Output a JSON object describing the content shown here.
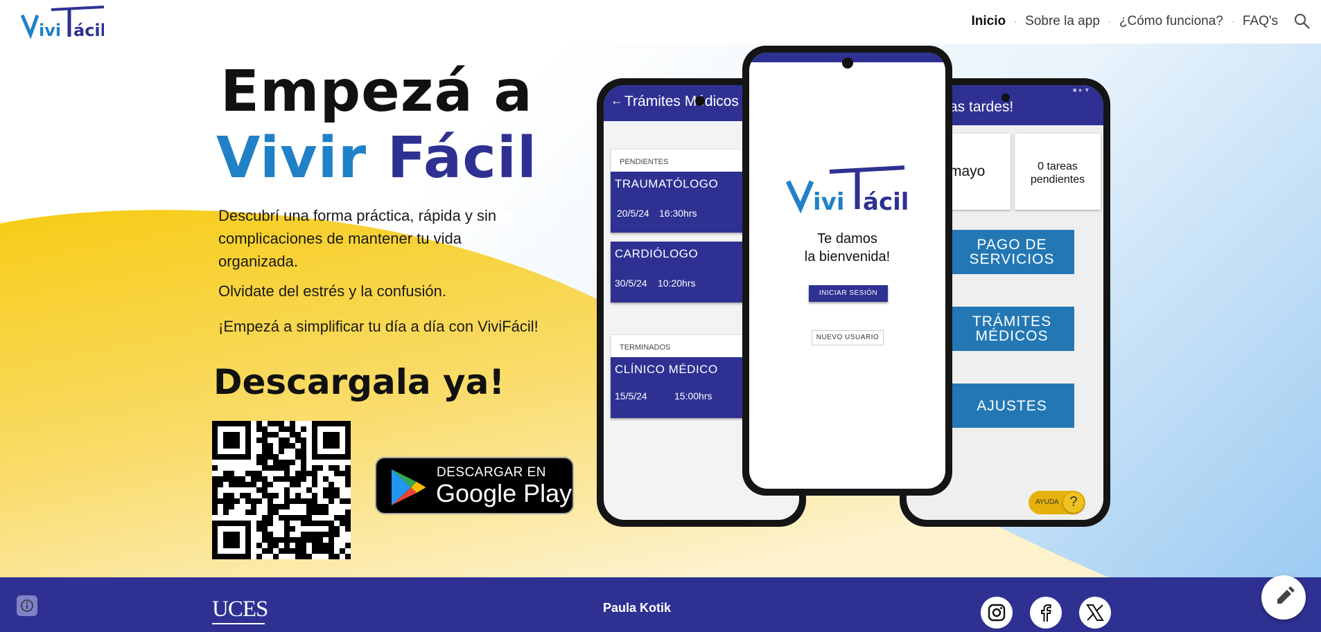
{
  "nav": {
    "logo_text": "ViviFácil",
    "links": [
      "Inicio",
      "Sobre la app",
      "¿Cómo funciona?",
      "FAQ's"
    ],
    "active": "Inicio",
    "sep": "·"
  },
  "hero": {
    "title_line1": "Empezá a",
    "title_word1": "Vivir",
    "title_word2": "Fácil",
    "description": "Descubrí una forma práctica, rápida y sin complicaciones de mantener tu vida organizada.",
    "para2": "Olvidate del estrés y la confusión.",
    "para3": "¡Empezá a simplificar tu día a día con ViviFácil!",
    "download_heading": "Descargala ya!",
    "gplay_top": "DESCARGAR EN",
    "gplay_bottom": "Google Play"
  },
  "phone_left": {
    "header": "Trámites Médicos",
    "section_pending": "PENDIENTES",
    "cards": [
      {
        "title": "TRAUMATÓLOGO",
        "date": "20/5/24",
        "time": "16:30hrs"
      },
      {
        "title": "CARDIÓLOGO",
        "date": "30/5/24",
        "time": "10:20hrs"
      }
    ],
    "section_done": "TERMINADOS",
    "done_card": {
      "title": "CLÍNICO MÉDICO",
      "date": "15/5/24",
      "time": "15:00hrs"
    }
  },
  "phone_center": {
    "logo_text": "ViviFácil",
    "welcome_line1": "Te damos",
    "welcome_line2": "la bienvenida!",
    "login_button": "INICIAR SESIÓN",
    "new_user_button": "NUEVO USUARIO"
  },
  "phone_right": {
    "header": "as tardes!",
    "card1_text": "mayo",
    "card1_dot": ".",
    "card2_line1": "0 tareas",
    "card2_line2": "pendientes",
    "btn1_line1": "PAGO DE",
    "btn1_line2": "SERVICIOS",
    "btn2_line1": "TRÁMITES",
    "btn2_line2": "MÉDICOS",
    "btn3": "AJUSTES",
    "help_label": "AYUDA",
    "help_symbol": "?"
  },
  "footer": {
    "university": "UCES",
    "author": "Paula Kotik",
    "social": [
      "instagram",
      "facebook",
      "x"
    ]
  },
  "colors": {
    "brand_dark": "#2e3192",
    "brand_light": "#2081c6",
    "yellow": "#f7cc15",
    "button_blue": "#2378b4"
  }
}
